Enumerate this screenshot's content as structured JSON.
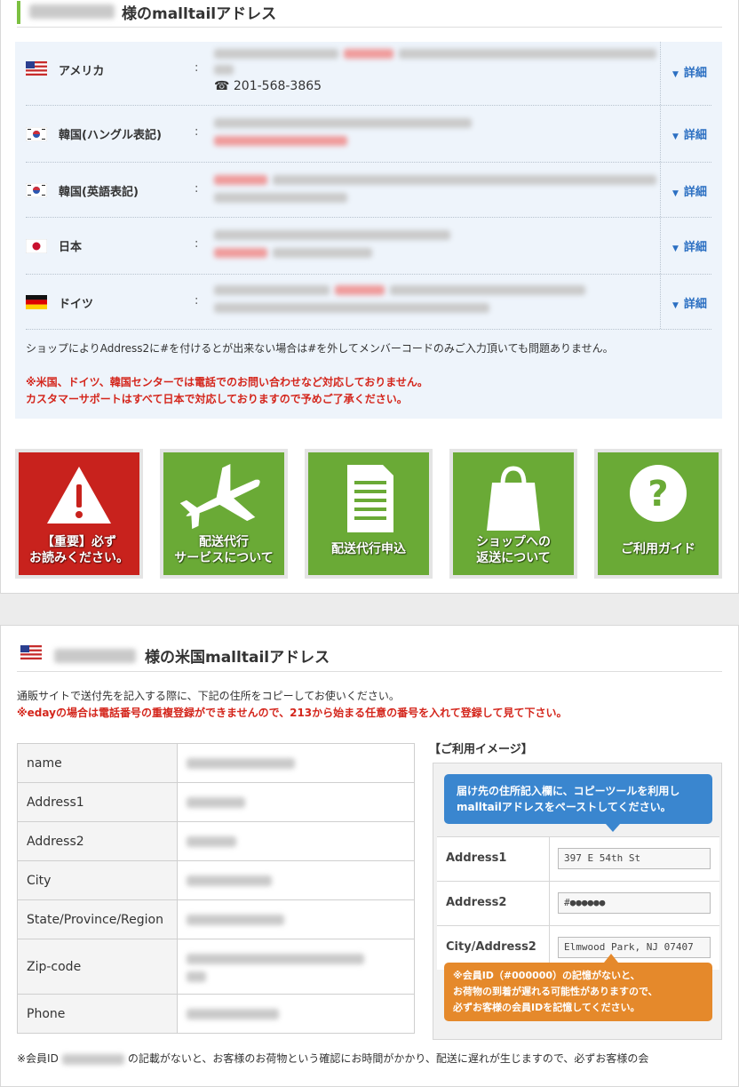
{
  "card1": {
    "title": "様のmalltailアドレス",
    "rows": [
      {
        "flag": "us-flag",
        "country": "アメリカ",
        "colon": ":",
        "phone": "☎ 201-568-3865",
        "detail": "詳細"
      },
      {
        "flag": "kr-flag",
        "country": "韓国(ハングル表記)",
        "colon": ":",
        "detail": "詳細"
      },
      {
        "flag": "kr-flag",
        "country": "韓国(英語表記)",
        "colon": ":",
        "detail": "詳細"
      },
      {
        "flag": "jp-flag",
        "country": "日本",
        "colon": ":",
        "detail": "詳細"
      },
      {
        "flag": "de-flag",
        "country": "ドイツ",
        "colon": ":",
        "detail": "詳細"
      }
    ],
    "note_black": "ショップによりAddress2に#を付けるとが出来ない場合は#を外してメンバーコードのみご入力頂いても問題ありません。",
    "note_red1": "※米国、ドイツ、韓国センターでは電話でのお問い合わせなど対応しておりません。",
    "note_red2": "カスタマーサポートはすべて日本で対応しておりますので予めご了承ください。",
    "tiles": [
      {
        "line1": "【重要】必ず",
        "line2": "お読みください。",
        "icon": "warning-icon"
      },
      {
        "line1": "配送代行",
        "line2": "サービスについて",
        "icon": "airplane-icon"
      },
      {
        "line1": "配送代行申込",
        "line2": "",
        "icon": "document-icon"
      },
      {
        "line1": "ショップへの",
        "line2": "返送について",
        "icon": "shopping-bag-icon"
      },
      {
        "line1": "ご利用ガイド",
        "line2": "",
        "icon": "question-icon"
      }
    ]
  },
  "card2": {
    "title": "様の米国malltailアドレス",
    "intro": "通販サイトで送付先を記入する際に、下記の住所をコピーしてお使いください。",
    "intro_red": "※edayの場合は電話番号の重複登録ができませんので、213から始まる任意の番号を入れて登録して見て下さい。",
    "table": [
      {
        "key": "name"
      },
      {
        "key": "Address1"
      },
      {
        "key": "Address2"
      },
      {
        "key": "City"
      },
      {
        "key": "State/Province/Region"
      },
      {
        "key": "Zip-code"
      },
      {
        "key": "Phone"
      }
    ],
    "usage_title": "【ご利用イメージ】",
    "bubble_blue_1": "届け先の住所記入欄に、コピーツールを利用し",
    "bubble_blue_2": "malltailアドレスをペーストしてください。",
    "usage_rows": [
      {
        "label": "Address1",
        "value": "397 E 54th St"
      },
      {
        "label": "Address2",
        "value": "#●●●●●●"
      },
      {
        "label": "City/Address2",
        "value": "Elmwood Park, NJ 07407"
      }
    ],
    "bubble_orange_1": "※会員ID（#000000）の記憶がないと、",
    "bubble_orange_2": "お荷物の到着が遅れる可能性がありますので、",
    "bubble_orange_3": "必ずお客様の会員IDを記憶してください。",
    "footnote_a": "※会員ID",
    "footnote_b": "の記載がないと、お客様のお荷物という確認にお時間がかかり、配送に遅れが生じますので、必ずお客様の会"
  }
}
